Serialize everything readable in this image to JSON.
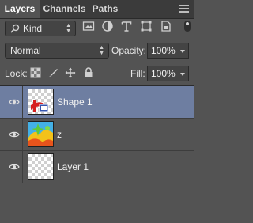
{
  "tabs": [
    {
      "label": "Layers",
      "active": true
    },
    {
      "label": "Channels",
      "active": false
    },
    {
      "label": "Paths",
      "active": false
    }
  ],
  "filter": {
    "kind_label": "Kind",
    "icons": [
      "image-filter-icon",
      "adjustment-filter-icon",
      "type-filter-icon",
      "shape-filter-icon",
      "smart-object-filter-icon"
    ]
  },
  "blend": {
    "mode": "Normal",
    "opacity_label": "Opacity:",
    "opacity_value": "100%"
  },
  "lock": {
    "label": "Lock:",
    "fill_label": "Fill:",
    "fill_value": "100%"
  },
  "layers": [
    {
      "name": "Shape 1",
      "selected": true,
      "visible": true
    },
    {
      "name": "z",
      "selected": false,
      "visible": true
    },
    {
      "name": "Layer 1",
      "selected": false,
      "visible": true
    }
  ],
  "colors": {
    "panel": "#535353",
    "selection": "#6e7ea1",
    "tab_bar": "#3b3b3b",
    "shape_red": "#d62020",
    "shape_blue": "#2f5fd8"
  }
}
